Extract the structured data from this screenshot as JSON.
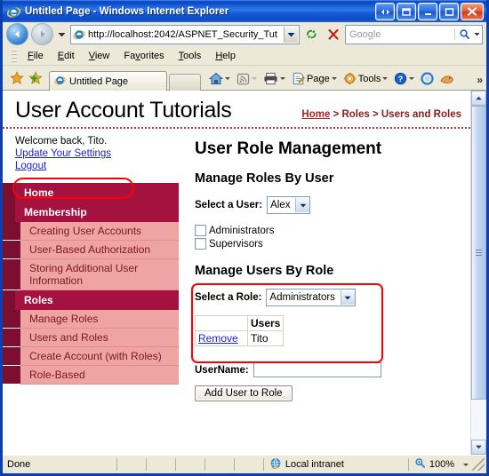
{
  "window": {
    "title": "Untitled Page - Windows Internet Explorer",
    "buttons": {
      "restore_group": "Restore Group",
      "restore_window": "Restore Window",
      "minimize": "Minimize",
      "maximize": "Maximize",
      "close": "Close"
    }
  },
  "address_bar": {
    "url": "http://localhost:2042/ASPNET_Security_Tut",
    "refresh_label": "Refresh",
    "stop_label": "Stop"
  },
  "search": {
    "placeholder": "Google",
    "value": "",
    "go_label": "Search"
  },
  "menu": {
    "items": [
      {
        "pre": "",
        "key": "F",
        "post": "ile"
      },
      {
        "pre": "",
        "key": "E",
        "post": "dit"
      },
      {
        "pre": "",
        "key": "V",
        "post": "iew"
      },
      {
        "pre": "Fa",
        "key": "v",
        "post": "orites"
      },
      {
        "pre": "",
        "key": "T",
        "post": "ools"
      },
      {
        "pre": "",
        "key": "H",
        "post": "elp"
      }
    ]
  },
  "tabs": {
    "favorites_label": "Favorites Center",
    "add_favorites_label": "Add to Favorites",
    "items": [
      {
        "label": "Untitled Page"
      }
    ],
    "new_tab_label": "New Tab"
  },
  "command_bar": {
    "home": "Home",
    "feeds": "Feeds",
    "print": "Print",
    "page": "Page",
    "tools": "Tools",
    "help": "Help",
    "overflow": "»"
  },
  "page": {
    "site_title": "User Account Tutorials",
    "breadcrumb": {
      "home": "Home",
      "rest": " > Roles > Users and Roles"
    },
    "welcome": {
      "greeting": "Welcome back, Tito.",
      "settings_link": "Update Your Settings",
      "logout_link": "Logout"
    },
    "nav": [
      {
        "type": "head",
        "label": "Home"
      },
      {
        "type": "head",
        "label": "Membership"
      },
      {
        "type": "sub",
        "label": "Creating User Accounts"
      },
      {
        "type": "sub",
        "label": "User-Based Authorization"
      },
      {
        "type": "sub",
        "label": "Storing Additional User Information"
      },
      {
        "type": "head",
        "label": "Roles"
      },
      {
        "type": "sub",
        "label": "Manage Roles"
      },
      {
        "type": "sub",
        "label": "Users and Roles"
      },
      {
        "type": "sub",
        "label": "Create Account (with Roles)"
      },
      {
        "type": "sub",
        "label": "Role-Based"
      }
    ],
    "main": {
      "heading": "User Role Management",
      "section_one": {
        "heading": "Manage Roles By User",
        "select_label": "Select a User:",
        "selected_user": "Alex",
        "roles": [
          {
            "label": "Administrators",
            "checked": false
          },
          {
            "label": "Supervisors",
            "checked": false
          }
        ]
      },
      "section_two": {
        "heading": "Manage Users By Role",
        "select_label": "Select a Role:",
        "selected_role": "Administrators",
        "table": {
          "headers": [
            "",
            "Users"
          ],
          "rows": [
            {
              "action": "Remove",
              "user": "Tito"
            }
          ]
        },
        "username_label": "UserName:",
        "username_value": "",
        "add_button": "Add User to Role"
      }
    }
  },
  "status_bar": {
    "status": "Done",
    "zone": "Local intranet",
    "zoom": "100%"
  },
  "colors": {
    "accent_dark": "#A5123F",
    "accent_darker": "#7C0E2F",
    "accent_light": "#EFA3A3",
    "annotation": "#FF0000",
    "link": "#2020D0",
    "breadcrumb": "#8C1A1A"
  }
}
